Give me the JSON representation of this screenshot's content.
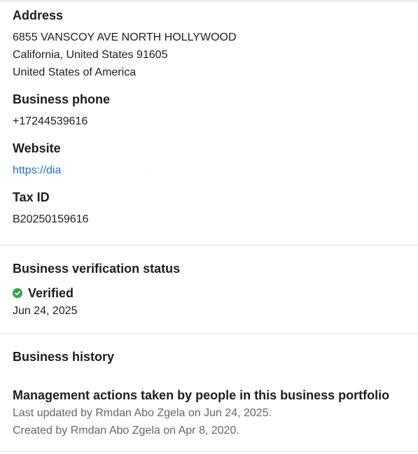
{
  "address": {
    "label": "Address",
    "lines": [
      "6855 VANSCOY AVE NORTH HOLLYWOOD",
      "California, United States 91605",
      "United States of America"
    ]
  },
  "phone": {
    "label": "Business phone",
    "value": "+17244539616"
  },
  "website": {
    "label": "Website",
    "value": "https://dia"
  },
  "tax": {
    "label": "Tax ID",
    "value": "B20250159616"
  },
  "verification": {
    "label": "Business verification status",
    "status": "Verified",
    "status_color": "#31a24c",
    "date": "Jun 24, 2025"
  },
  "history": {
    "label": "Business history",
    "management_title": "Management actions taken by people in this business portfolio",
    "last_updated": "Last updated by Rmdan Abo Zgela on Jun 24, 2025.",
    "created": "Created by Rmdan Abo Zgela on Apr 8, 2020."
  }
}
